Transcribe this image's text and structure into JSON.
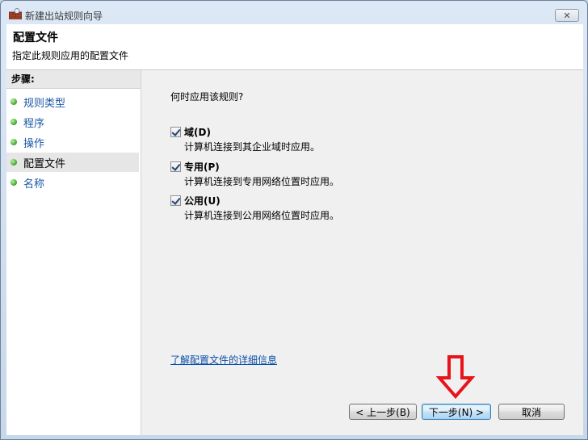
{
  "window": {
    "title": "新建出站规则向导",
    "close_glyph": "✕"
  },
  "header": {
    "title": "配置文件",
    "subtitle": "指定此规则应用的配置文件"
  },
  "sidebar": {
    "steps_label": "步骤:",
    "items": [
      {
        "label": "规则类型"
      },
      {
        "label": "程序"
      },
      {
        "label": "操作"
      },
      {
        "label": "配置文件"
      },
      {
        "label": "名称"
      }
    ]
  },
  "main": {
    "question": "何时应用该规则?",
    "options": [
      {
        "label": "域(D)",
        "description": "计算机连接到其企业域时应用。",
        "checked": true
      },
      {
        "label": "专用(P)",
        "description": "计算机连接到专用网络位置时应用。",
        "checked": true
      },
      {
        "label": "公用(U)",
        "description": "计算机连接到公用网络位置时应用。",
        "checked": true
      }
    ],
    "learn_link": "了解配置文件的详细信息"
  },
  "buttons": {
    "back": "< 上一步(B)",
    "next": "下一步(N) >",
    "cancel": "取消"
  },
  "colors": {
    "link": "#0a4fa8",
    "annotation_arrow": "#e8141a"
  },
  "annotation": {
    "icon": "red-down-arrow-icon"
  }
}
